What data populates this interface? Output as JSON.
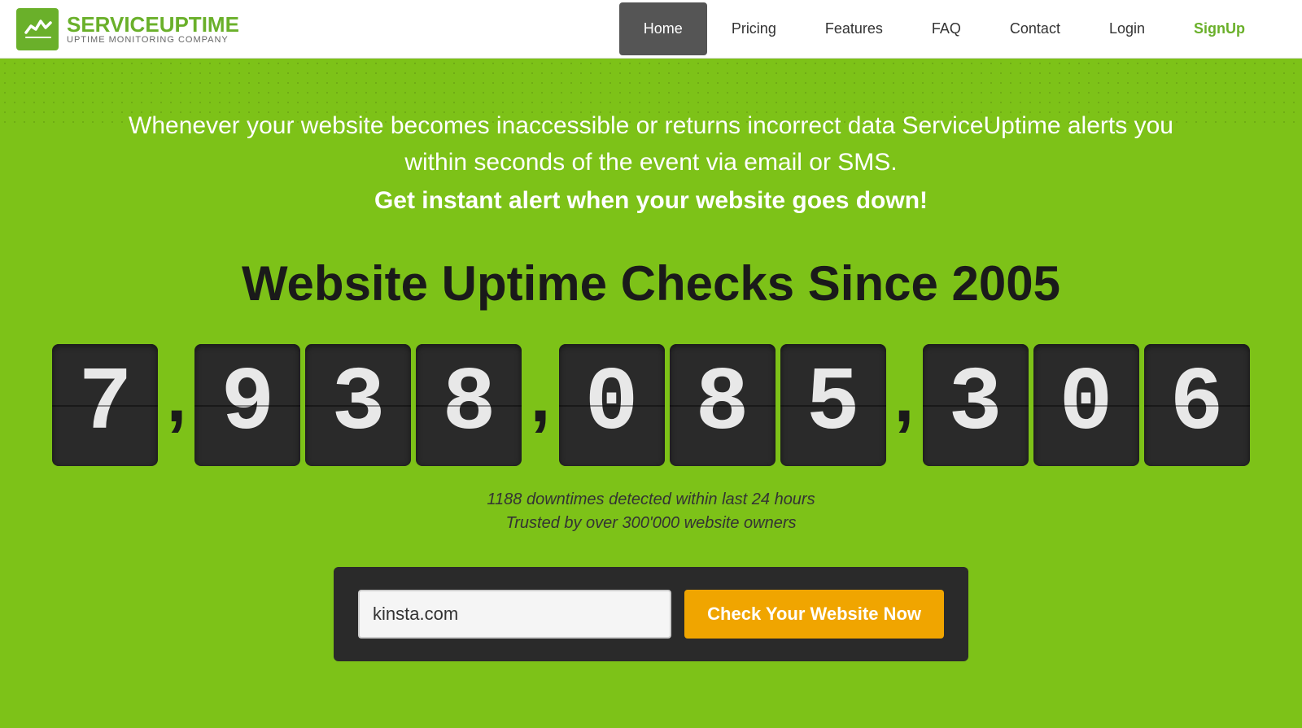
{
  "logo": {
    "brand_part1": "SERVICE",
    "brand_part2": "UPTIME",
    "tagline": "UPTIME MONITORING COMPANY"
  },
  "navbar": {
    "links": [
      {
        "label": "Home",
        "active": true
      },
      {
        "label": "Pricing",
        "active": false
      },
      {
        "label": "Features",
        "active": false
      },
      {
        "label": "FAQ",
        "active": false
      },
      {
        "label": "Contact",
        "active": false
      },
      {
        "label": "Login",
        "active": false
      },
      {
        "label": "SignUp",
        "active": false,
        "special": "signup"
      }
    ]
  },
  "hero": {
    "description": "Whenever your website becomes inaccessible or returns incorrect data ServiceUptime alerts you within seconds of the event via email or SMS.",
    "cta_text": "Get instant alert when your website goes down!",
    "counter_title": "Website Uptime Checks Since 2005",
    "counter_digits": [
      "7",
      "9",
      "3",
      "8",
      "0",
      "8",
      "5",
      "3",
      "0",
      "6"
    ],
    "counter_display": "7,938,085,306",
    "stats_line1": "1188 downtimes detected within last 24 hours",
    "stats_line2": "Trusted by over 300'000 website owners",
    "input_placeholder": "kinsta.com",
    "input_value": "kinsta.com",
    "button_label": "Check Your Website Now"
  }
}
